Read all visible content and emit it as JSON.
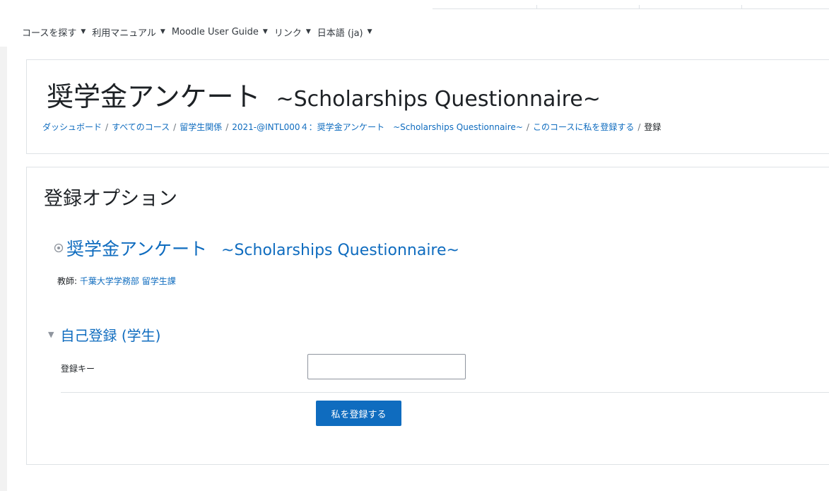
{
  "navbar": {
    "items": [
      {
        "label": "コースを探す"
      },
      {
        "label": "利用マニュアル"
      },
      {
        "label": "Moodle User Guide"
      },
      {
        "label": "リンク"
      },
      {
        "label": "日本語 (ja)"
      }
    ]
  },
  "header": {
    "title_ja": "奨学金アンケート",
    "title_en": "~Scholarships Questionnaire~",
    "breadcrumb": [
      "ダッシュボード",
      "すべてのコース",
      "留学生関係",
      "2021-@INTL000４：奨学金アンケート　~Scholarships Questionnaire~",
      "このコースに私を登録する",
      "登録"
    ]
  },
  "main": {
    "section_title": "登録オプション",
    "course_name_ja": "奨学金アンケート",
    "course_name_en": "~Scholarships Questionnaire~",
    "teacher_label": "教師:",
    "teacher_name": "千葉大学学務部 留学生課",
    "self_enrol_title": "自己登録 (学生)",
    "enrol_key_label": "登録キー",
    "enrol_key_value": "",
    "enrol_button": "私を登録する"
  },
  "colors": {
    "link": "#0f6cbf",
    "button": "#0f6cbf",
    "text": "#1d2125"
  }
}
